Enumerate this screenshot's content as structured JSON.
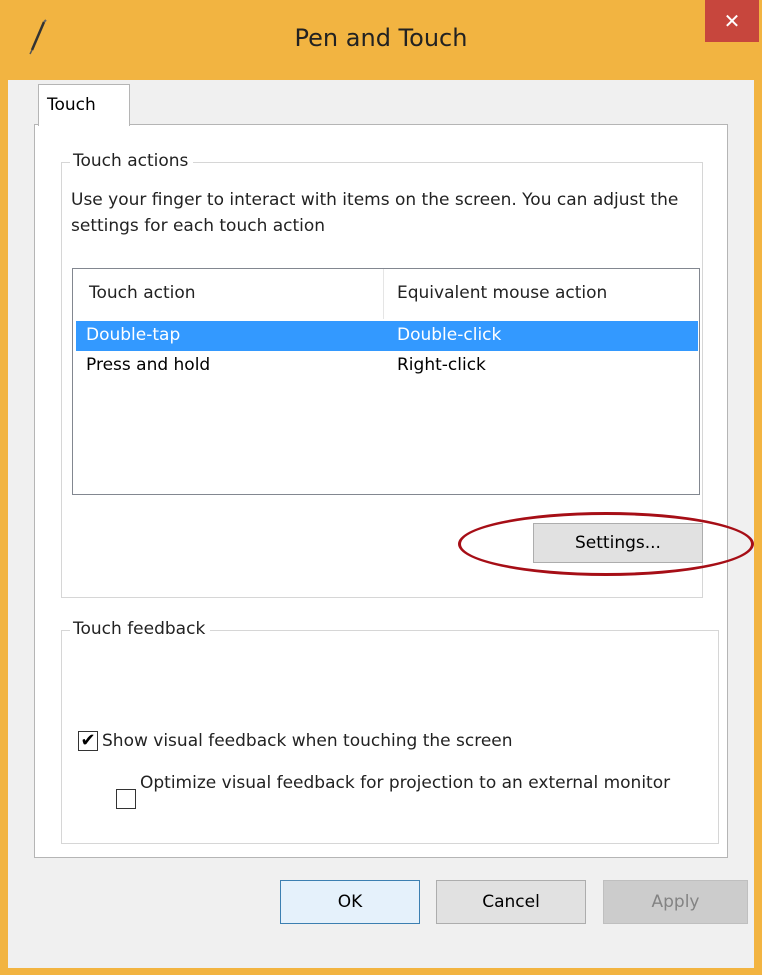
{
  "window": {
    "title": "Pen and Touch",
    "close_glyph": "✕",
    "title_icon": "pen-icon"
  },
  "tabs": [
    {
      "label": "Touch"
    }
  ],
  "touch_actions": {
    "group_label": "Touch actions",
    "description": "Use your finger to interact with items on the screen. You can adjust the settings for each touch action",
    "columns": [
      "Touch action",
      "Equivalent mouse action"
    ],
    "rows": [
      {
        "action": "Double-tap",
        "mouse": "Double-click",
        "selected": true
      },
      {
        "action": "Press and hold",
        "mouse": "Right-click",
        "selected": false
      }
    ],
    "settings_label": "Settings..."
  },
  "touch_feedback": {
    "group_label": "Touch feedback",
    "show_visual_feedback": {
      "label": "Show visual feedback when touching the screen",
      "checked": true
    },
    "optimize_projection": {
      "label": "Optimize visual feedback for projection to an external monitor",
      "checked": false
    }
  },
  "footer": {
    "ok_label": "OK",
    "cancel_label": "Cancel",
    "apply_label": "Apply"
  },
  "colors": {
    "titlebar": "#f2b441",
    "close_button": "#c7463d",
    "selection": "#3399ff",
    "annotation": "#a60e16"
  }
}
